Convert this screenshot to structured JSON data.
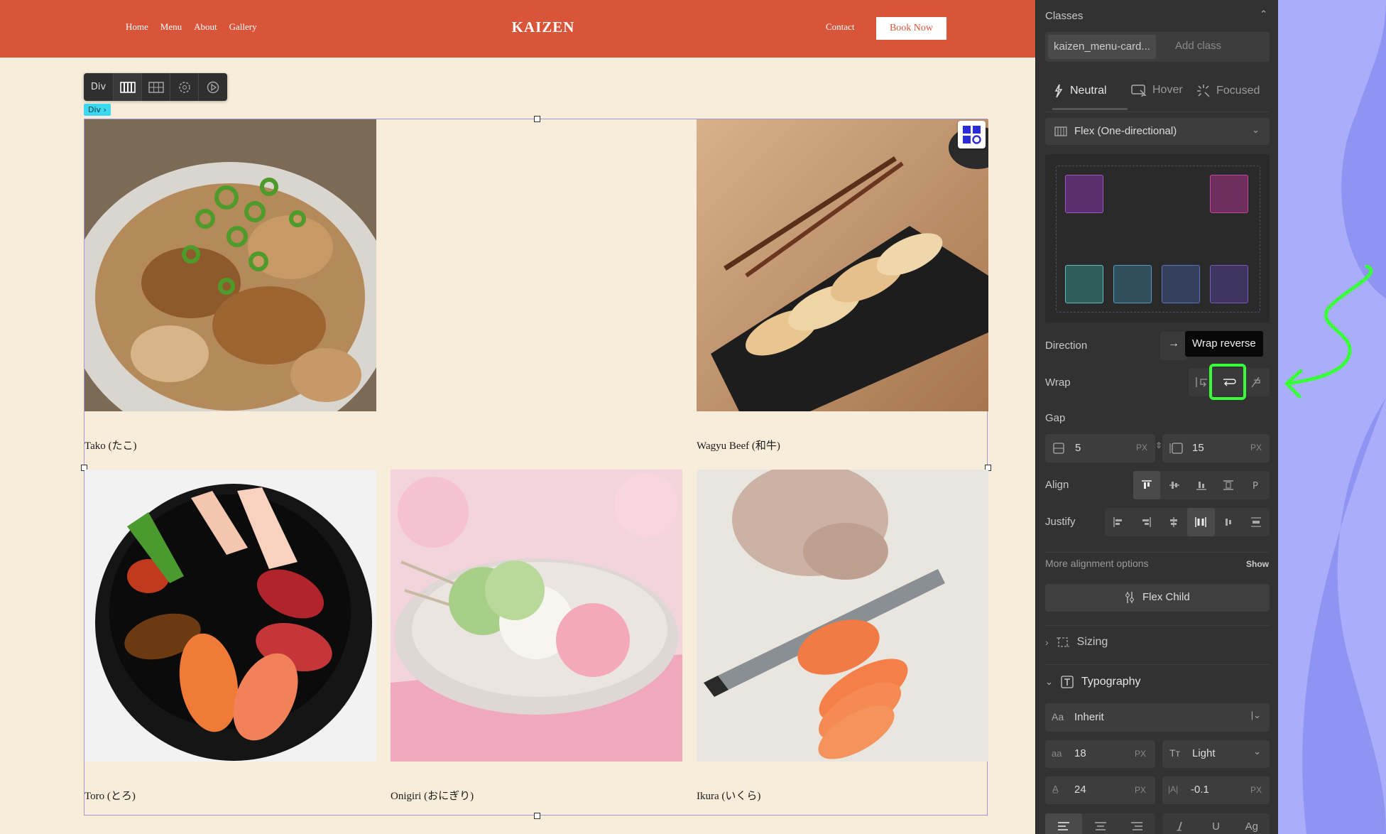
{
  "site": {
    "nav_items": [
      "Home",
      "Menu",
      "About",
      "Gallery"
    ],
    "brand": "KAIZEN",
    "contact": "Contact",
    "book_now": "Book Now"
  },
  "editor_toolbar": {
    "element_label": "Div",
    "breadcrumb": "Div"
  },
  "menu_cards": [
    {
      "caption": "Tako (たこ)"
    },
    {
      "caption": "Wagyu Beef (和牛)"
    },
    {
      "caption": "Toro (とろ)"
    },
    {
      "caption": "Onigiri (おにぎり)"
    },
    {
      "caption": "Ikura (いくら)"
    }
  ],
  "panel": {
    "classes_title": "Classes",
    "class_chip": "kaizen_menu-card...",
    "add_class_placeholder": "Add class",
    "states": [
      "Neutral",
      "Hover",
      "Focused"
    ],
    "layout_mode": "Flex (One-directional)",
    "direction_label": "Direction",
    "tooltip": "Wrap reverse",
    "wrap_label": "Wrap",
    "gap_label": "Gap",
    "gap_row": "5",
    "gap_col": "15",
    "unit_px": "PX",
    "align_label": "Align",
    "justify_label": "Justify",
    "more_alignment": "More alignment options",
    "show": "Show",
    "flex_child": "Flex Child",
    "sizing": "Sizing",
    "typography": "Typography",
    "font": "Inherit",
    "font_size": "18",
    "font_weight": "Light",
    "line_height": "24",
    "letter_spacing": "-0.1",
    "bottom_row": [
      "U",
      "Ag"
    ]
  },
  "colors": {
    "nav_bg": "#d9553a",
    "page_bg": "#f8eddb",
    "panel_bg": "#323232",
    "highlight": "#39ff3a",
    "deco": "#a9adfa"
  }
}
